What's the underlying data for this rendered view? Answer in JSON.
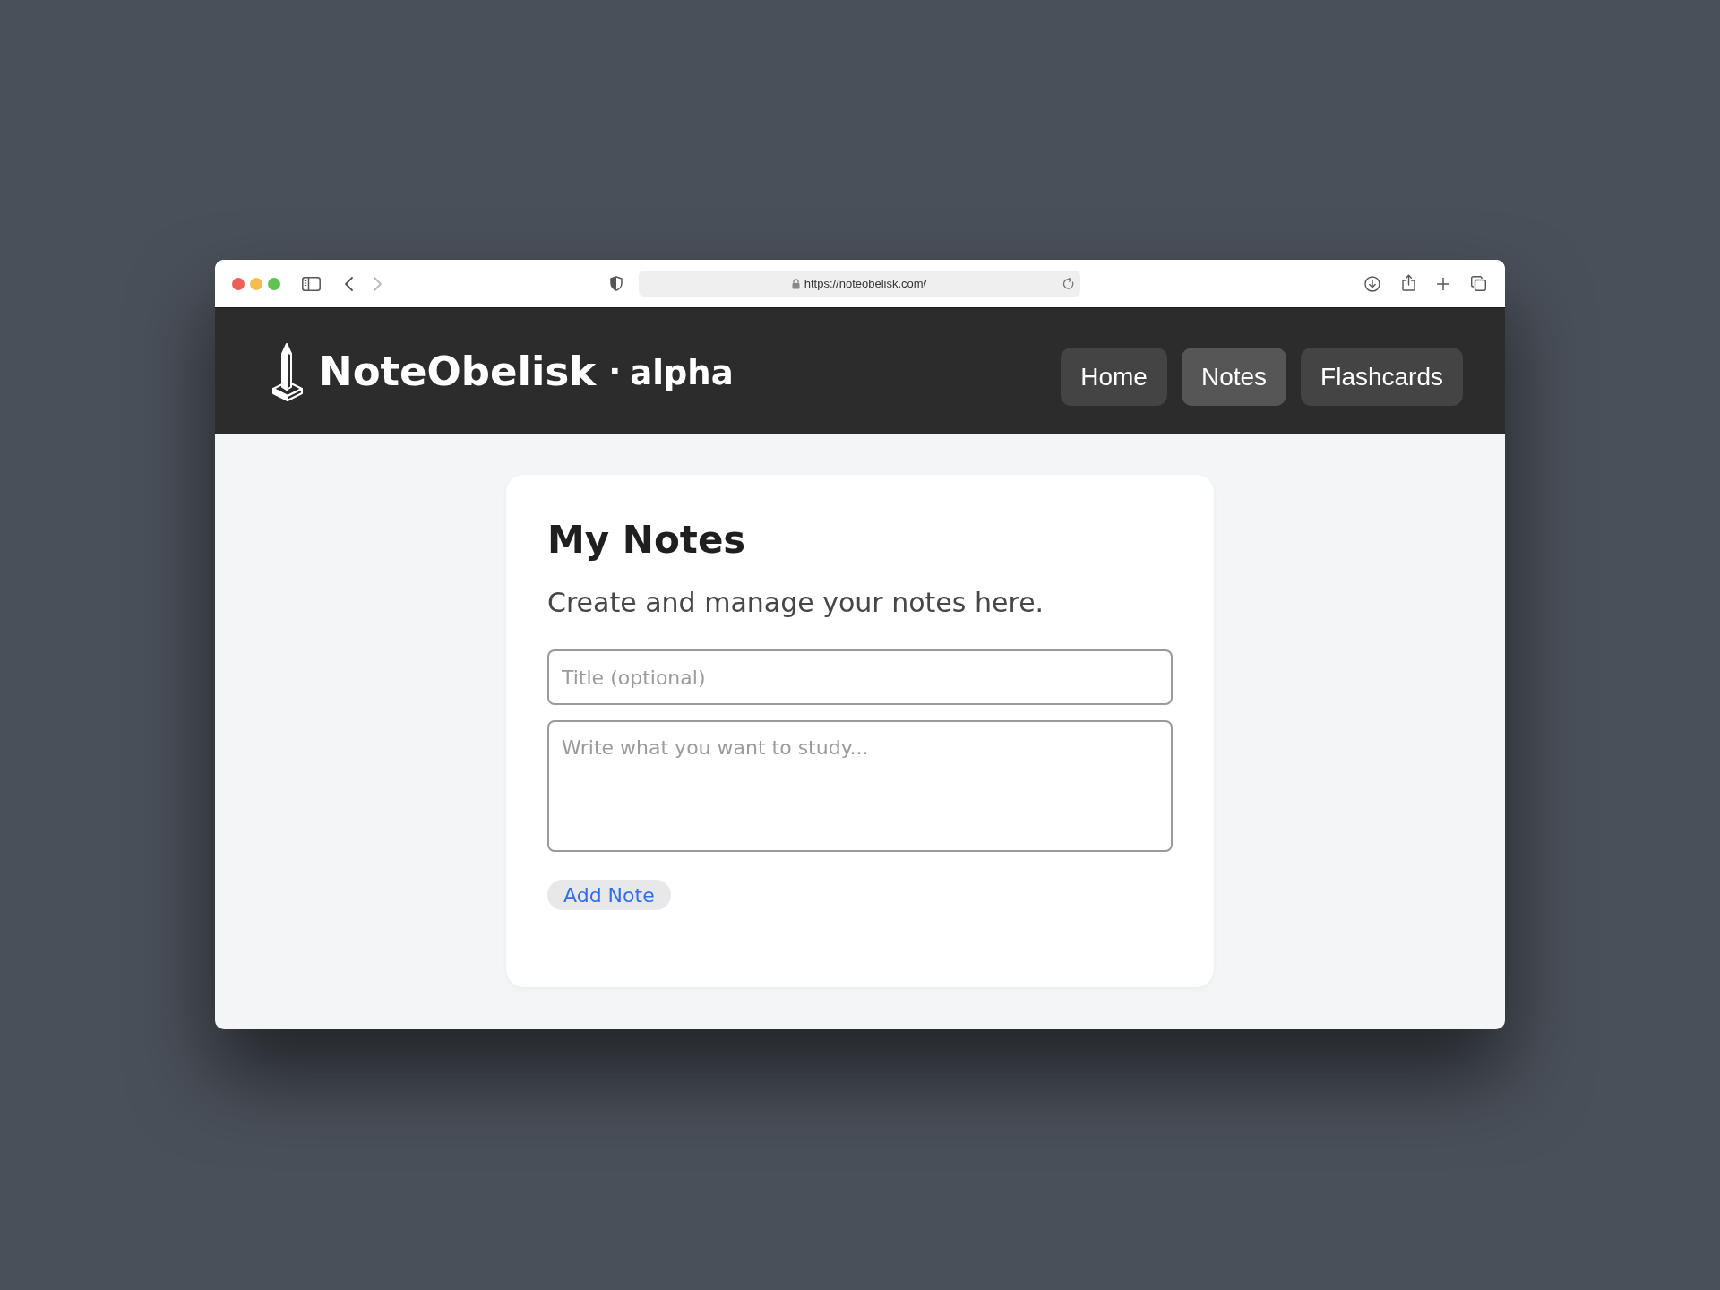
{
  "browser": {
    "url": "https://noteobelisk.com/"
  },
  "header": {
    "brand": "NoteObelisk",
    "separator": "·",
    "edition": "alpha",
    "nav": [
      {
        "label": "Home",
        "selected": false
      },
      {
        "label": "Notes",
        "selected": true
      },
      {
        "label": "Flashcards",
        "selected": false
      }
    ]
  },
  "card": {
    "title": "My Notes",
    "subtitle": "Create and manage your notes here.",
    "fields": [
      {
        "kind": "input",
        "placeholder": "Title (optional)"
      },
      {
        "kind": "textarea",
        "placeholder": "Write what you want to study..."
      }
    ],
    "button": "Add Note"
  }
}
